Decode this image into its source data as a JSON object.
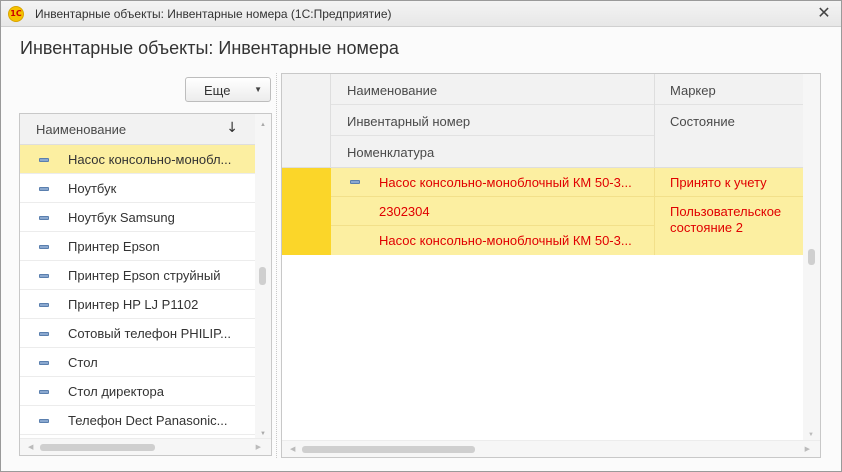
{
  "window": {
    "logo_text": "1C",
    "title": "Инвентарные объекты: Инвентарные номера  (1С:Предприятие)",
    "close_glyph": "✕"
  },
  "form": {
    "title": "Инвентарные объекты: Инвентарные номера"
  },
  "toolbar": {
    "more_label": "Еще",
    "more_arrow": "▼"
  },
  "left_list": {
    "header": "Наименование",
    "sort_glyph": "↓",
    "items": [
      "Насос консольно-монобл...",
      "Ноутбук",
      "Ноутбук Samsung",
      "Принтер Epson",
      "Принтер Epson струйный",
      "Принтер HP LJ P1102",
      "Сотовый телефон PHILIP...",
      "Стол",
      "Стол директора",
      "Телефон Dect Panasonic..."
    ],
    "selected_index": 0
  },
  "right_table": {
    "columns": {
      "name": "Наименование",
      "inventory_number": "Инвентарный номер",
      "nomenclature": "Номенклатура",
      "marker": "Маркер",
      "state": "Состояние"
    },
    "row": {
      "name": "Насос консольно-моноблочный КМ 50-3...",
      "inventory_number": "2302304",
      "nomenclature": "Насос консольно-моноблочный КМ 50-3...",
      "marker": "Принято к учету",
      "state": "Пользовательское состояние 2"
    }
  },
  "colors": {
    "selected_row": "#fcefa1",
    "marker_cell": "#fbd629",
    "row_text": "#e00000"
  }
}
